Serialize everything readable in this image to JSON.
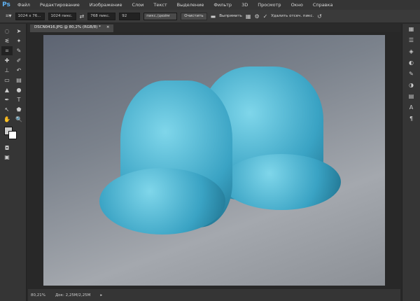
{
  "app": {
    "logo": "Ps"
  },
  "menu": [
    "Файл",
    "Редактирование",
    "Изображение",
    "Слои",
    "Текст",
    "Выделение",
    "Фильтр",
    "3D",
    "Просмотр",
    "Окно",
    "Справка"
  ],
  "options": {
    "ratio": "1024 x 76...",
    "width": "1024 пикс.",
    "height": "768 пикс.",
    "resolution": "92",
    "units": "пикс./дюйм",
    "clear": "Очистить",
    "straighten": "Выпрямить",
    "delete_cropped": "Удалить отсеч. пикс."
  },
  "document": {
    "tab_title": "DSCN0416.JPG @ 80,2% (RGB/8) *",
    "close": "×"
  },
  "status": {
    "zoom": "80,21%",
    "doc_size": "Док: 2,25M/2,25M"
  }
}
